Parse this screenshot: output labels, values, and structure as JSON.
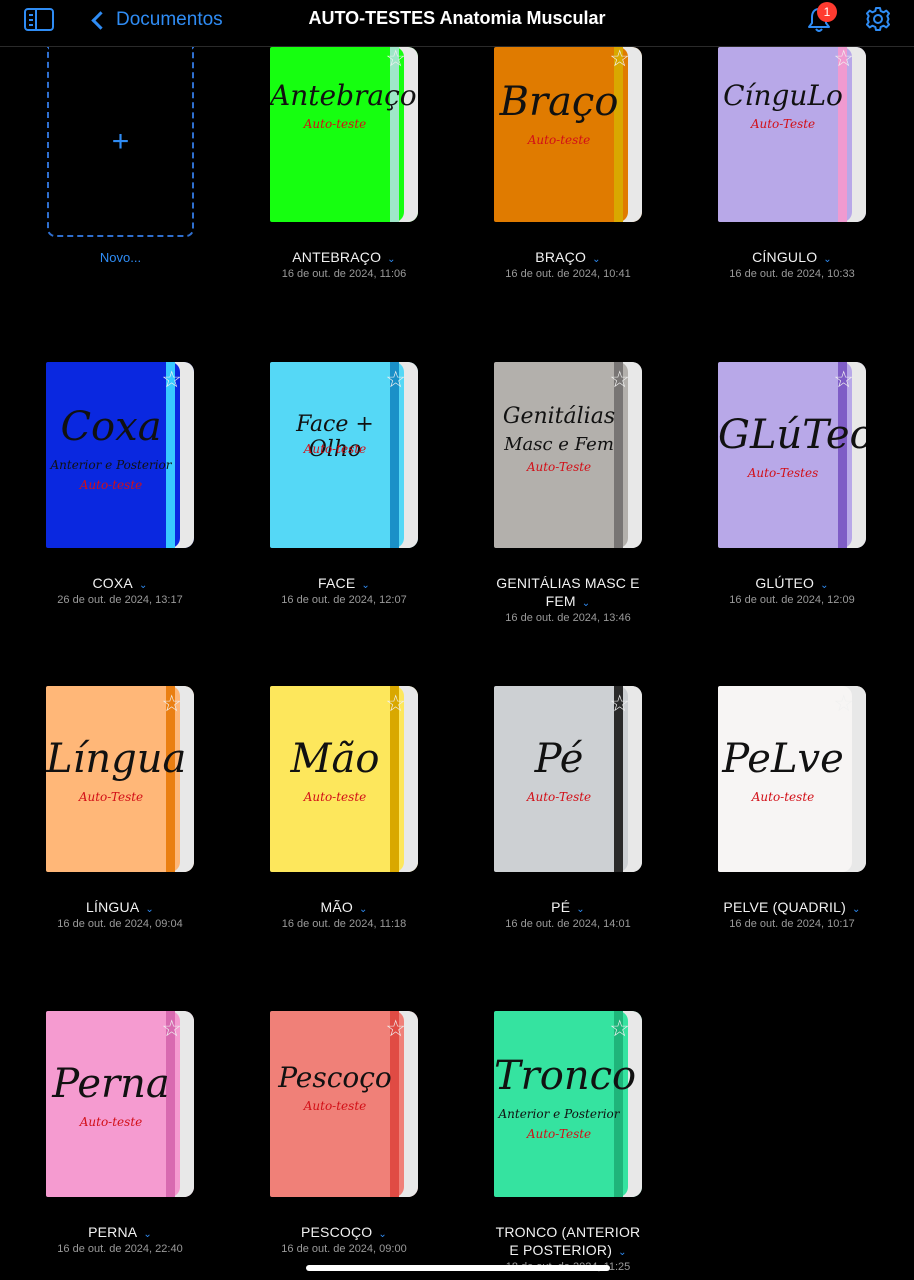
{
  "header": {
    "back_label": "Documentos",
    "title": "AUTO-TESTES Anatomia Muscular",
    "notification_count": "1"
  },
  "new_doc": {
    "plus": "+",
    "label": "Novo..."
  },
  "documents": [
    {
      "title": "ANTEBRAÇO",
      "date": "16 de out. de 2024, 11:06",
      "cover_title": "Antebraço",
      "cover_sub": "Auto-teste",
      "color": "#16ff10",
      "band": "#9fe7c9"
    },
    {
      "title": "BRAÇO",
      "date": "16 de out. de 2024, 10:41",
      "cover_title": "Braço",
      "cover_sub": "Auto-teste",
      "color": "#e07b00",
      "band": "#d9a800"
    },
    {
      "title": "CÍNGULO",
      "date": "16 de out. de 2024, 10:33",
      "cover_title": "CínguLo",
      "cover_sub": "Auto-Teste",
      "color": "#b8a8e8",
      "band": "#f09ad0"
    },
    {
      "title": "COXA",
      "date": "26 de out. de 2024, 13:17",
      "cover_title": "Coxa",
      "cover_line2": "Anterior e Posterior",
      "cover_sub": "Auto-teste",
      "color": "#0a28e0",
      "band": "#39c9ff"
    },
    {
      "title": "FACE",
      "date": "16 de out. de 2024, 12:07",
      "cover_title": "Face + Olho",
      "cover_sub": "Auto-teste",
      "color": "#55d8f6",
      "band": "#1a90c8"
    },
    {
      "title": "GENITÁLIAS MASC E FEM",
      "date": "16 de out. de 2024, 13:46",
      "cover_title": "Genitálias",
      "cover_line2": "Masc e Fem",
      "cover_sub": "Auto-Teste",
      "color": "#b3b0ac",
      "band": "#787574"
    },
    {
      "title": "GLÚTEO",
      "date": "16 de out. de 2024, 12:09",
      "cover_title": "GLúTeo",
      "cover_sub": "Auto-Testes",
      "color": "#b8a8e8",
      "band": "#7e5cc6"
    },
    {
      "title": "LÍNGUA",
      "date": "16 de out. de 2024, 09:04",
      "cover_title": "Língua",
      "cover_sub": "Auto-Teste",
      "color": "#ffb778",
      "band": "#ea7f12"
    },
    {
      "title": "MÃO",
      "date": "16 de out. de 2024, 11:18",
      "cover_title": "Mão",
      "cover_sub": "Auto-teste",
      "color": "#fde75c",
      "band": "#d9a800"
    },
    {
      "title": "PÉ",
      "date": "16 de out. de 2024, 14:01",
      "cover_title": "Pé",
      "cover_sub": "Auto-Teste",
      "color": "#cdd0d3",
      "band": "#2a2a2a"
    },
    {
      "title": "PELVE (QUADRIL)",
      "date": "16 de out. de 2024, 10:17",
      "cover_title": "PeLve",
      "cover_sub": "Auto-teste",
      "color": "#f7f5f4",
      "band": ""
    },
    {
      "title": "PERNA",
      "date": "16 de out. de 2024, 22:40",
      "cover_title": "Perna",
      "cover_sub": "Auto-teste",
      "color": "#f59bd0",
      "band": "#d86ab0"
    },
    {
      "title": "PESCOÇO",
      "date": "16 de out. de 2024, 09:00",
      "cover_title": "Pescoço",
      "cover_sub": "Auto-teste",
      "color": "#f08078",
      "band": "#e04b44"
    },
    {
      "title": "TRONCO (ANTERIOR E POSTERIOR)",
      "date": "18 de out. de 2024, 11:25",
      "cover_title": "Tronco",
      "cover_line2": "Anterior e Posterior",
      "cover_sub": "Auto-Teste",
      "color": "#35e3a0",
      "band": "#1fb57a"
    }
  ]
}
